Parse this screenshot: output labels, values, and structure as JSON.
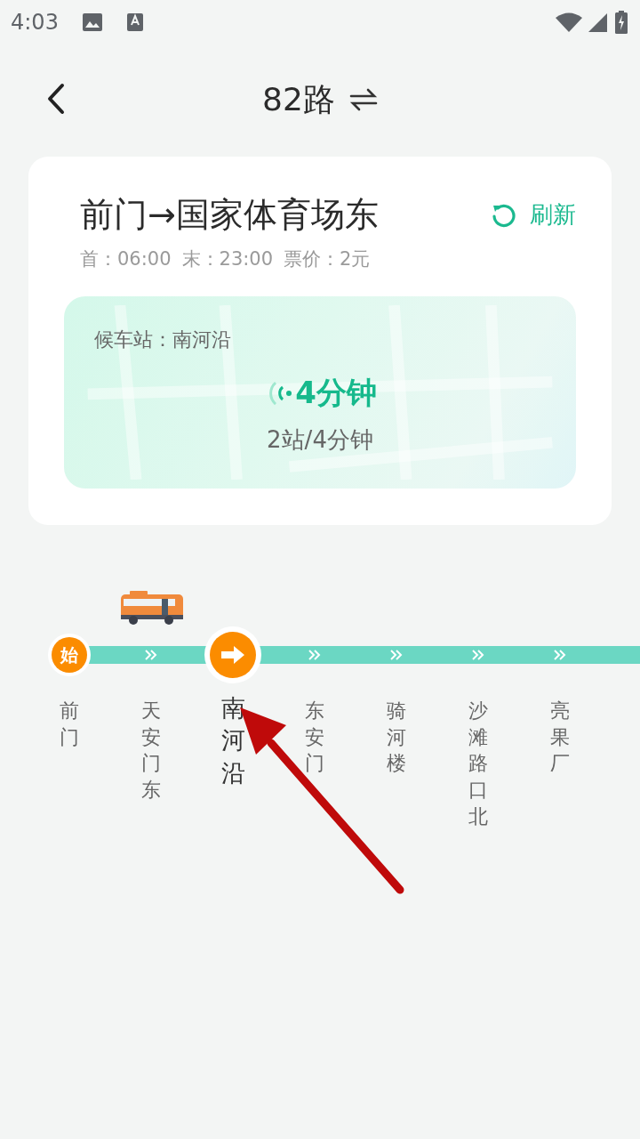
{
  "status_bar": {
    "time": "4:03"
  },
  "nav": {
    "title": "82路"
  },
  "route": {
    "title": "前门→国家体育场东",
    "refresh": "刷新",
    "first_label": "首：",
    "first_time": "06:00",
    "last_label": "末：",
    "last_time": "23:00",
    "fare_label": "票价：",
    "fare": "2元",
    "waiting_station": "候车站：南河沿",
    "eta": "4分钟",
    "distance": "2站/4分钟"
  },
  "stations": [
    {
      "name": "前门",
      "kind": "start",
      "badge": "始",
      "selected": false,
      "bus": false
    },
    {
      "name": "天安门东",
      "kind": "normal",
      "selected": false,
      "bus": true
    },
    {
      "name": "南河沿",
      "kind": "current",
      "selected": true,
      "bus": false
    },
    {
      "name": "东安门",
      "kind": "normal",
      "selected": false,
      "bus": false
    },
    {
      "name": "骑河楼",
      "kind": "normal",
      "selected": false,
      "bus": false
    },
    {
      "name": "沙滩路口北",
      "kind": "normal",
      "selected": false,
      "bus": false
    },
    {
      "name": "亮果厂",
      "kind": "normal",
      "selected": false,
      "bus": false
    }
  ]
}
